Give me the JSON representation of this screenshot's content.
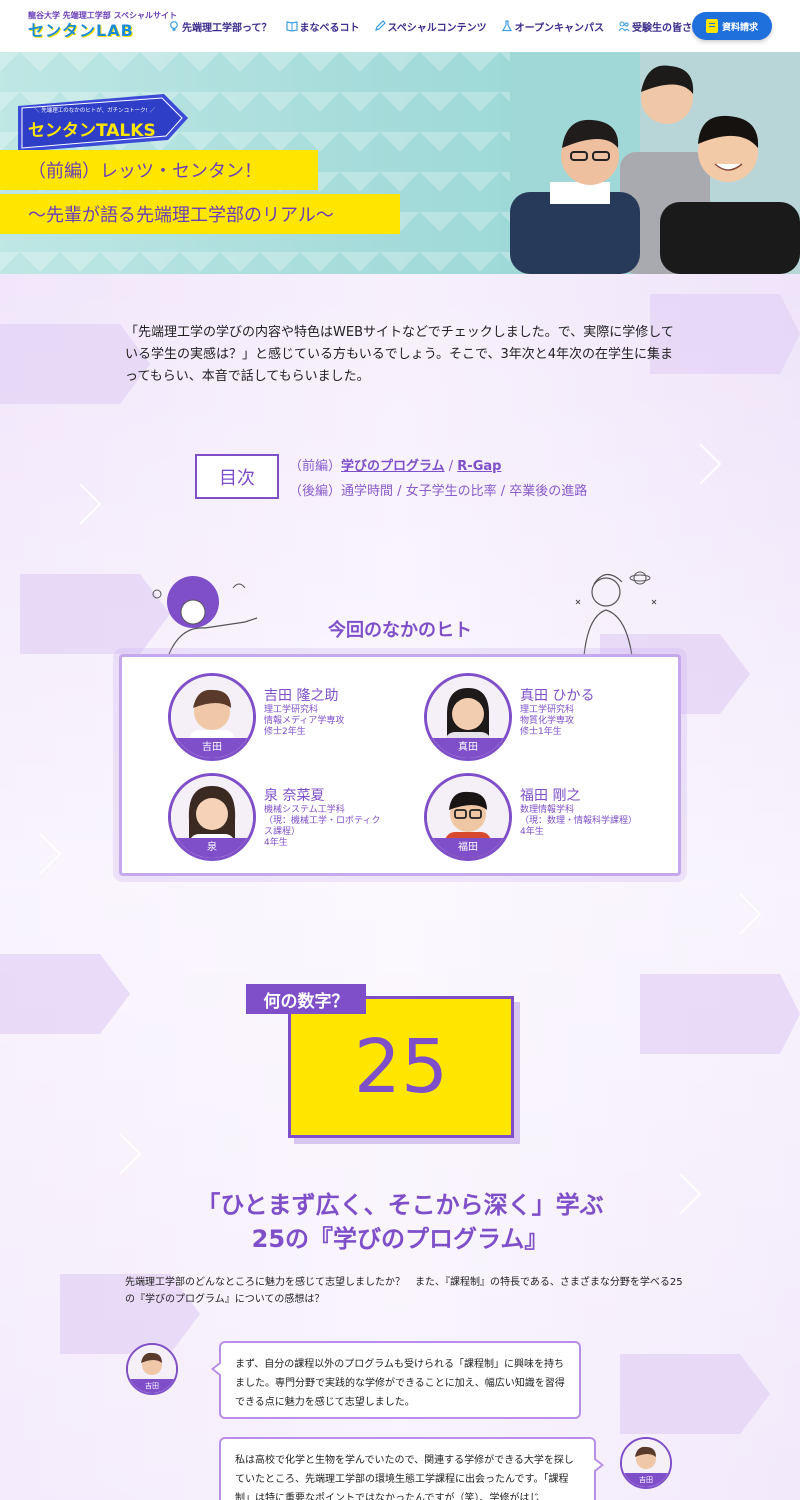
{
  "colors": {
    "accent": "#7e4fc9",
    "yellow": "#ffe600",
    "header_nav": "#3d2d8c",
    "button_blue": "#1f6fdc",
    "hero_teal": "#a6dcdb"
  },
  "header": {
    "logo_sub": "龍谷大学 先端理工学部 スペシャルサイト",
    "logo_main": "センタンLAB",
    "nav": [
      {
        "label": "先端理工学部って？",
        "icon": "lightbulb-icon"
      },
      {
        "label": "まなべるコト",
        "icon": "book-icon"
      },
      {
        "label": "スペシャルコンテンツ",
        "icon": "pencil-icon"
      },
      {
        "label": "オープンキャンパス",
        "icon": "flask-icon"
      },
      {
        "label": "受験生の皆さんへ",
        "icon": "people-icon"
      }
    ],
    "request_button": "資料請求"
  },
  "hero": {
    "badge_small": "＼ 先端理工のなかのヒトが、ガチンコトーク! ／",
    "badge_main": "センタンTALKS",
    "title_line1": "（前編）レッツ・センタン！",
    "title_line2": "〜先輩が語る先端理工学部のリアル〜"
  },
  "intro": "「先端理工学の学びの内容や特色はWEBサイトなどでチェックしました。で、実際に学修している学生の実感は？」と感じている方もいるでしょう。そこで、3年次と4年次の在学生に集まってもらい、本音で話してもらいました。",
  "toc": {
    "label": "目次",
    "first_prefix": "（前編）",
    "first_link1": "学びのプログラム",
    "sep": " / ",
    "first_link2": "R-Gap",
    "second": "（後編）通学時間 / 女子学生の比率 / 卒業後の進路"
  },
  "members": {
    "title": "今回のなかのヒト",
    "list": [
      {
        "name": "吉田 隆之助",
        "dept": "理工学研究科\n情報メディア学専攻\n修士2年生",
        "tag": "吉田"
      },
      {
        "name": "真田 ひかる",
        "dept": "理工学研究科\n物質化学専攻\n修士1年生",
        "tag": "真田"
      },
      {
        "name": "泉 奈菜夏",
        "dept": "機械システム工学科\n（現：機械工学・ロボティクス課程）\n4年生",
        "tag": "泉"
      },
      {
        "name": "福田 剛之",
        "dept": "数理情報学科\n（現：数理・情報科学課程）\n4年生",
        "tag": "福田"
      }
    ]
  },
  "number_section": {
    "question": "何の数字？",
    "number": "25",
    "title_line1": "「ひとまず広く、そこから深く」学ぶ",
    "title_line2": "25の『学びのプログラム』",
    "lead": "先端理工学部のどんなところに魅力を感じて志望しましたか？　また、『課程制』の特長である、さまざまな分野を学べる25の『学びのプログラム』についての感想は？"
  },
  "chat": [
    {
      "speaker": "吉田",
      "text": "まず、自分の課程以外のプログラムも受けられる「課程制」に興味を持ちました。専門分野で実践的な学修ができることに加え、幅広い知識を習得できる点に魅力を感じて志望しました。"
    },
    {
      "speaker": "吉田",
      "text": "私は高校で化学と生物を学んでいたので、関連する学修ができる大学を探していたところ、先端理工学部の環境生態工学課程に出会ったんです。「課程制」は特に重要なポイントではなかったんですが（笑）、学修がはじ"
    }
  ]
}
